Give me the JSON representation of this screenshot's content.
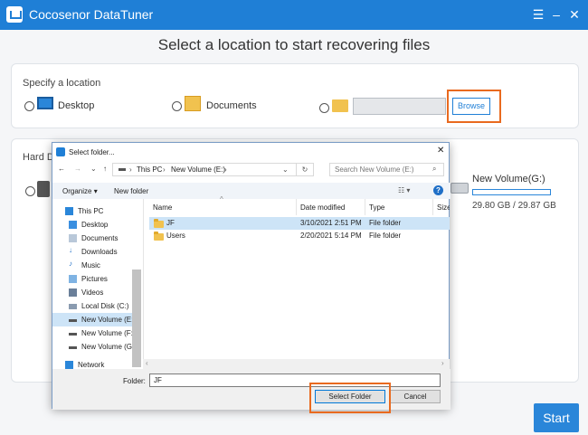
{
  "app": {
    "title": "Cocosenor DataTuner",
    "headline": "Select a location to start recovering files",
    "start_label": "Start"
  },
  "specify": {
    "label": "Specify a location",
    "desktop": "Desktop",
    "documents": "Documents",
    "browse_label": "Browse"
  },
  "hard_disk": {
    "label": "Hard D",
    "drive_g": {
      "name": "New Volume(G:)",
      "size": "29.80 GB / 29.87 GB"
    }
  },
  "dialog": {
    "title": "Select folder...",
    "path": {
      "root": "This PC",
      "volume": "New Volume (E:)"
    },
    "search_placeholder": "Search New Volume (E:)",
    "organize": "Organize",
    "new_folder": "New folder",
    "nav": [
      "This PC",
      "Desktop",
      "Documents",
      "Downloads",
      "Music",
      "Pictures",
      "Videos",
      "Local Disk (C:)",
      "New Volume (E:)",
      "New Volume (F:)",
      "New Volume (G:",
      "Network"
    ],
    "columns": {
      "name": "Name",
      "date": "Date modified",
      "type": "Type",
      "size": "Size"
    },
    "files": [
      {
        "name": "JF",
        "date": "3/10/2021 2:51 PM",
        "type": "File folder"
      },
      {
        "name": "Users",
        "date": "2/20/2021 5:14 PM",
        "type": "File folder"
      }
    ],
    "folder_label": "Folder:",
    "folder_value": "JF",
    "select_label": "Select Folder",
    "cancel_label": "Cancel"
  }
}
